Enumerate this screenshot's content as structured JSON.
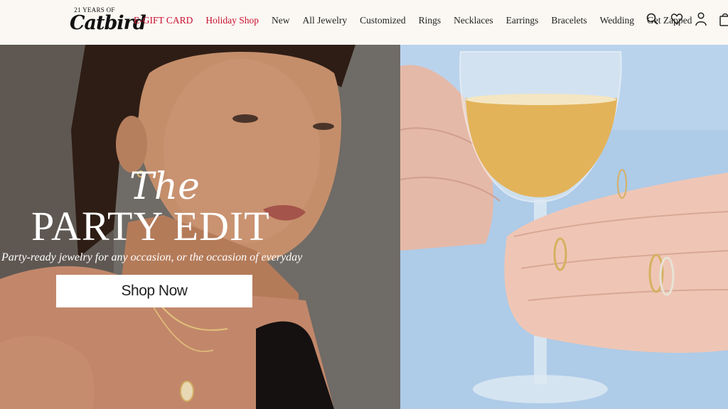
{
  "header": {
    "logo": {
      "small_text": "21 YEARS OF",
      "brand": "Catbird"
    },
    "nav": [
      {
        "label": "E-GIFT CARD",
        "highlight": true
      },
      {
        "label": "Holiday Shop",
        "highlight": true
      },
      {
        "label": "New"
      },
      {
        "label": "All Jewelry"
      },
      {
        "label": "Customized"
      },
      {
        "label": "Rings"
      },
      {
        "label": "Necklaces"
      },
      {
        "label": "Earrings"
      },
      {
        "label": "Bracelets"
      },
      {
        "label": "Wedding"
      },
      {
        "label": "Get Zapped"
      }
    ],
    "icons": [
      "search-icon",
      "heart-icon",
      "account-icon",
      "cart-icon"
    ]
  },
  "hero": {
    "title_script": "The",
    "title_main": "PARTY EDIT",
    "tagline": "Party-ready jewelry for any occasion, or the occasion of everyday",
    "cta_label": "Shop Now"
  },
  "colors": {
    "accent_red": "#c8102e",
    "text": "#222222",
    "header_bg": "#fbf8f3"
  }
}
